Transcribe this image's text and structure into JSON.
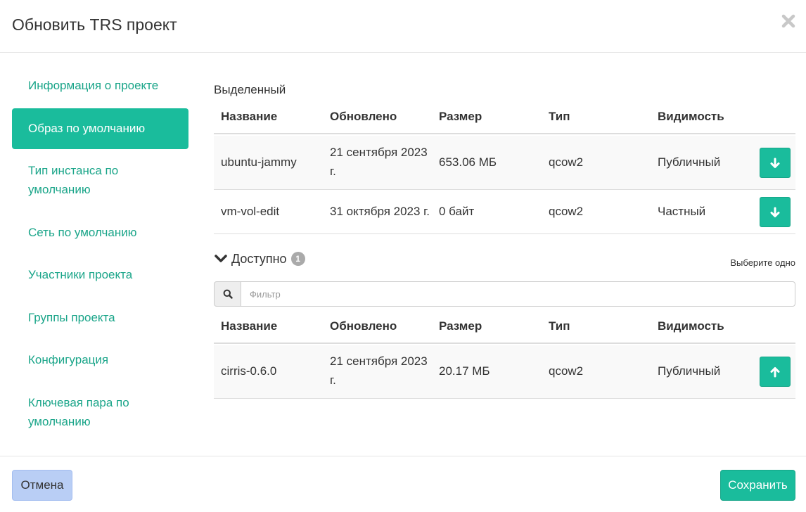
{
  "modal": {
    "title": "Обновить TRS проект",
    "close_icon": "close-icon"
  },
  "sidebar": {
    "items": [
      {
        "label": "Информация о проекте",
        "active": false
      },
      {
        "label": "Образ по умолчанию",
        "active": true
      },
      {
        "label": "Тип инстанса по умолчанию",
        "active": false
      },
      {
        "label": "Сеть по умолчанию",
        "active": false
      },
      {
        "label": "Участники проекта",
        "active": false
      },
      {
        "label": "Группы проекта",
        "active": false
      },
      {
        "label": "Конфигурация",
        "active": false
      },
      {
        "label": "Ключевая пара по умолчанию",
        "active": false
      }
    ]
  },
  "allocated": {
    "label": "Выделенный",
    "columns": {
      "name": "Название",
      "updated": "Обновлено",
      "size": "Размер",
      "type": "Тип",
      "visibility": "Видимость"
    },
    "rows": [
      {
        "name": "ubuntu-jammy",
        "updated": "21 сентября 2023 г.",
        "size": "653.06 МБ",
        "type": "qcow2",
        "visibility": "Публичный",
        "action_icon": "arrow-down-icon"
      },
      {
        "name": "vm-vol-edit",
        "updated": "31 октября 2023 г.",
        "size": "0 байт",
        "type": "qcow2",
        "visibility": "Частный",
        "action_icon": "arrow-down-icon"
      }
    ]
  },
  "available": {
    "label": "Доступно",
    "count": "1",
    "help": "Выберите одно",
    "toggle_icon": "chevron-down-icon",
    "filter": {
      "placeholder": "Фильтр",
      "value": "",
      "icon": "search-icon"
    },
    "columns": {
      "name": "Название",
      "updated": "Обновлено",
      "size": "Размер",
      "type": "Тип",
      "visibility": "Видимость"
    },
    "rows": [
      {
        "name": "cirris-0.6.0",
        "updated": "21 сентября 2023 г.",
        "size": "20.17 МБ",
        "type": "qcow2",
        "visibility": "Публичный",
        "action_icon": "arrow-up-icon"
      }
    ]
  },
  "footer": {
    "cancel_label": "Отмена",
    "save_label": "Сохранить"
  },
  "colors": {
    "accent": "#1abc9c",
    "link": "#1aa589",
    "cancel": "#b9cef5",
    "badge": "#aaaaaa"
  }
}
